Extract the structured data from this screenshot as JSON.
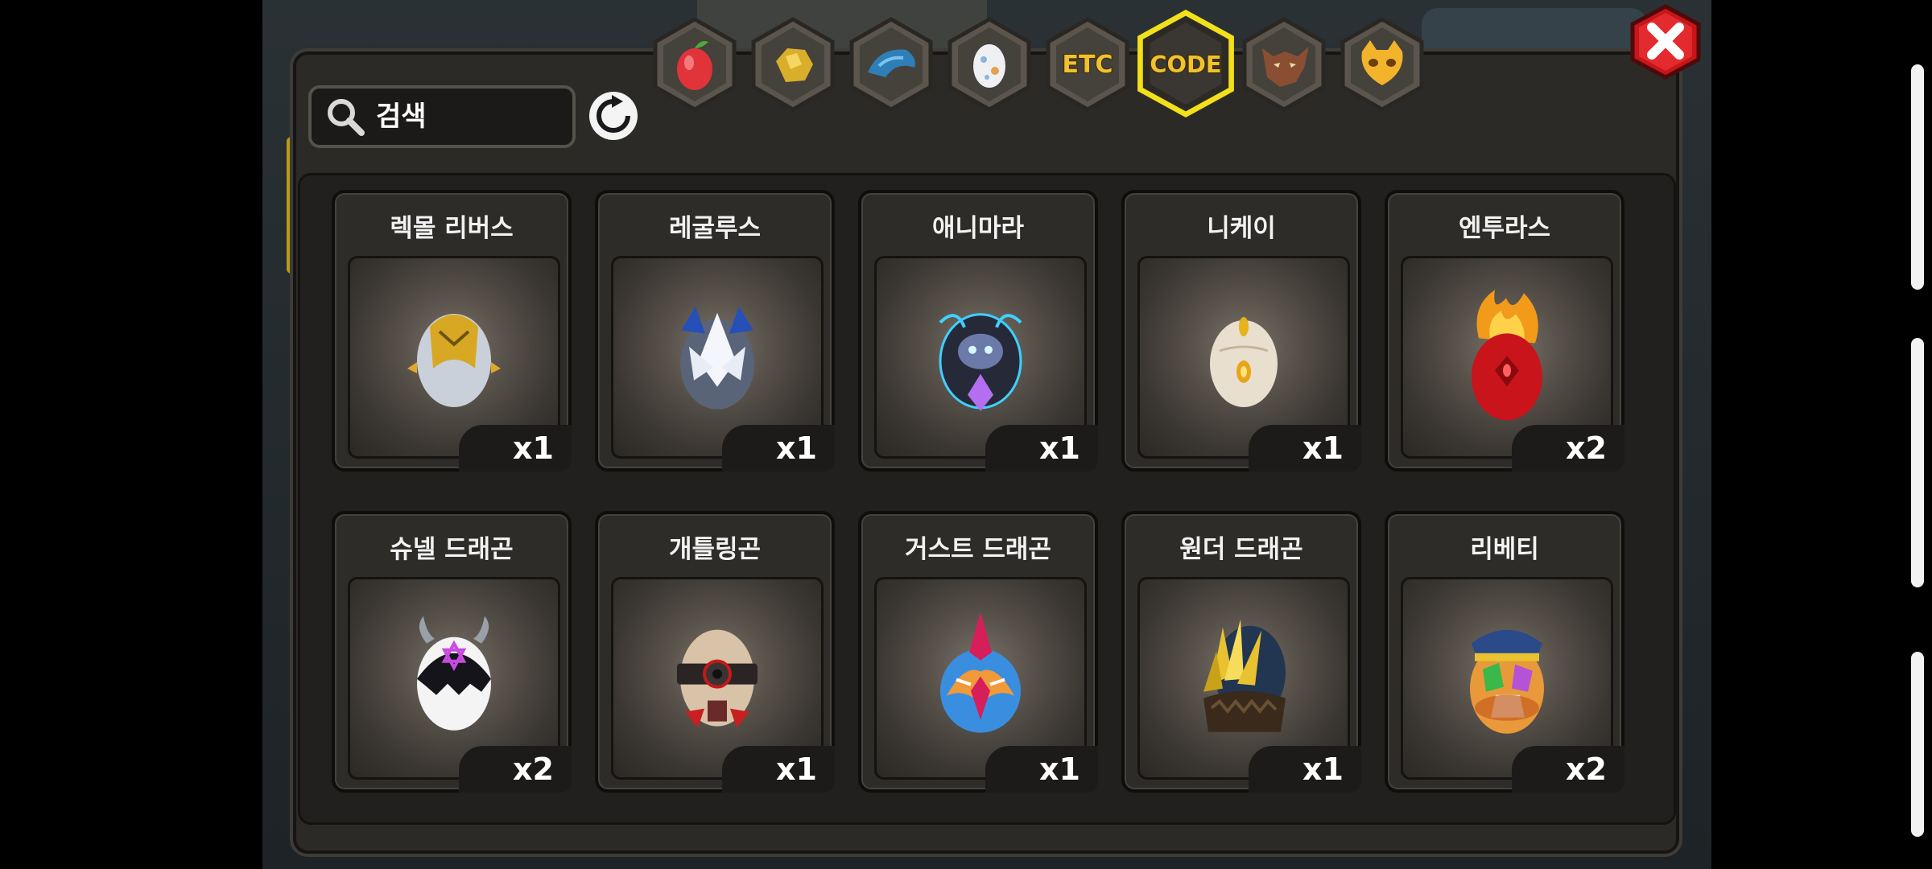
{
  "search": {
    "placeholder": "검색"
  },
  "tabs": [
    {
      "name": "fruit"
    },
    {
      "name": "gold-nugget"
    },
    {
      "name": "dragon-food"
    },
    {
      "name": "egg"
    },
    {
      "name": "etc",
      "label": "ETC"
    },
    {
      "name": "code",
      "label": "CODE",
      "selected": true
    },
    {
      "name": "wolf"
    },
    {
      "name": "mask"
    }
  ],
  "items": [
    {
      "name": "렉몰 리버스",
      "count": "x1",
      "icon": "silver-gold-egg"
    },
    {
      "name": "레굴루스",
      "count": "x1",
      "icon": "blue-spiked-egg"
    },
    {
      "name": "애니마라",
      "count": "x1",
      "icon": "dark-crystal-egg"
    },
    {
      "name": "니케이",
      "count": "x1",
      "icon": "cream-gem-egg"
    },
    {
      "name": "엔투라스",
      "count": "x2",
      "icon": "red-flame-egg"
    },
    {
      "name": "슈넬 드래곤",
      "count": "x2",
      "icon": "star-horn-egg"
    },
    {
      "name": "개틀링곤",
      "count": "x1",
      "icon": "gatling-egg"
    },
    {
      "name": "거스트 드래곤",
      "count": "x1",
      "icon": "blue-crested-egg"
    },
    {
      "name": "원더 드래곤",
      "count": "x1",
      "icon": "golden-spike-egg"
    },
    {
      "name": "리베티",
      "count": "x2",
      "icon": "captain-hat-egg"
    }
  ],
  "colors": {
    "selected_tab_ring": "#f2e01a",
    "close_button": "#d4181c"
  }
}
